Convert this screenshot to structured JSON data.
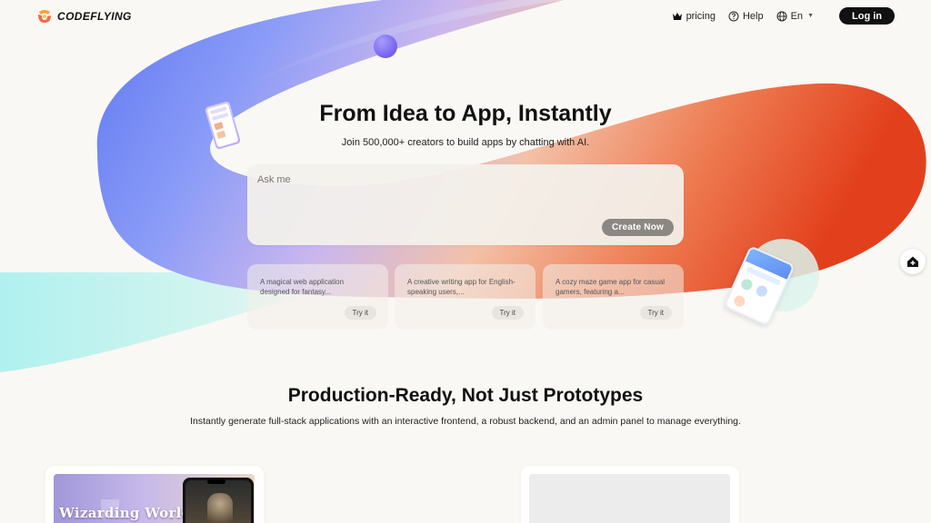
{
  "header": {
    "brand": "CODEFLYING",
    "nav": {
      "pricing_label": "pricing",
      "help_label": "Help",
      "language_label": "En",
      "login_label": "Log in"
    }
  },
  "hero": {
    "title": "From Idea to App, Instantly",
    "subtitle": "Join 500,000+ creators to build apps by chatting with AI.",
    "input_placeholder": "Ask me",
    "input_value": "",
    "create_label": "Create Now"
  },
  "examples": [
    {
      "text": "A magical web application designed for fantasy...",
      "action": "Try it"
    },
    {
      "text": "A creative writing app for English-speaking users,...",
      "action": "Try it"
    },
    {
      "text": "A cozy maze game app for casual gamers, featuring a...",
      "action": "Try it"
    }
  ],
  "section": {
    "title": "Production-Ready, Not Just Prototypes",
    "subtitle": "Instantly generate full-stack applications with an interactive frontend, a robust backend, and an admin panel to manage everything."
  },
  "demos": {
    "left_caption": "Wizarding World"
  },
  "icons": {
    "crown": "crown-icon",
    "help": "help-circle-icon",
    "globe": "globe-icon",
    "caret": "caret-down-icon",
    "float": "home-plus-icon"
  },
  "colors": {
    "background": "#faf8f4",
    "swirl_blue": "#7b8cf0",
    "swirl_orange": "#e84a22",
    "swirl_cyan": "#a9f0ee",
    "login_bg": "#111111",
    "create_btn": "#8b8782"
  }
}
